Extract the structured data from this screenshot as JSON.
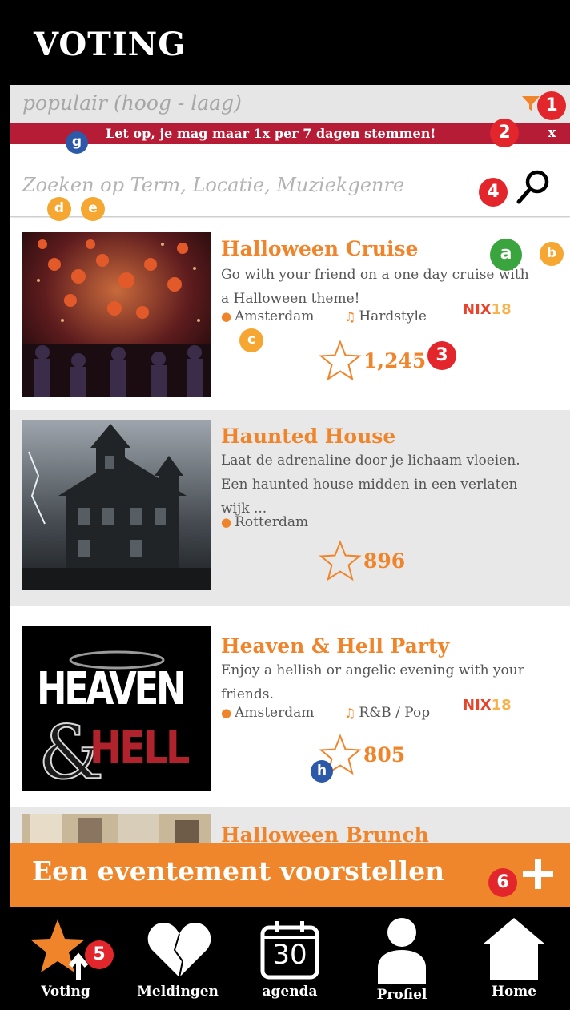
{
  "app": {
    "title": "VOTING"
  },
  "sort": {
    "label": "populair (hoog - laag)"
  },
  "notice": {
    "text": "Let op, je mag maar 1x per 7 dagen stemmen!",
    "close": "x"
  },
  "search": {
    "placeholder": "Zoeken op Term, Locatie, Muziekgenre",
    "value": ""
  },
  "events": [
    {
      "title": "Halloween Cruise",
      "description": "Go with your friend on a one day cruise with a Halloween theme!",
      "location": "Amsterdam",
      "genre": "Hardstyle",
      "votes": "1,245",
      "brand": [
        "NIX",
        "18"
      ]
    },
    {
      "title": "Haunted House",
      "description": "Laat de adrenaline door je lichaam vloeien. Een haunted house midden in een verlaten wijk ...",
      "location": "Rotterdam",
      "votes": "896"
    },
    {
      "title": "Heaven & Hell Party",
      "description": "Enjoy a hellish or angelic evening with your friends.",
      "location": "Amsterdam",
      "genre": "R&B / Pop",
      "votes": "805",
      "brand": [
        "NIX",
        "18"
      ],
      "poster": {
        "line1": "HEAVEN",
        "amp": "&",
        "line2": "HELL"
      }
    },
    {
      "title": "Halloween Brunch"
    }
  ],
  "propose": {
    "label": "Een eventement voorstellen"
  },
  "nav": [
    {
      "label": "Voting",
      "icon": "star-icon"
    },
    {
      "label": "Meldingen",
      "icon": "heart-icon"
    },
    {
      "label": "agenda",
      "icon": "calendar-icon",
      "day": "30"
    },
    {
      "label": "Profiel",
      "icon": "person-icon"
    },
    {
      "label": "Home",
      "icon": "home-icon"
    }
  ],
  "markers": {
    "m1": "1",
    "m2": "2",
    "m3": "3",
    "m4": "4",
    "m5": "5",
    "m6": "6",
    "a": "a",
    "b": "b",
    "c": "c",
    "d": "d",
    "e": "e",
    "g": "g",
    "h": "h"
  },
  "colors": {
    "accent": "#f0842b",
    "notice": "#b61c35",
    "marker_red": "#e3262b"
  }
}
